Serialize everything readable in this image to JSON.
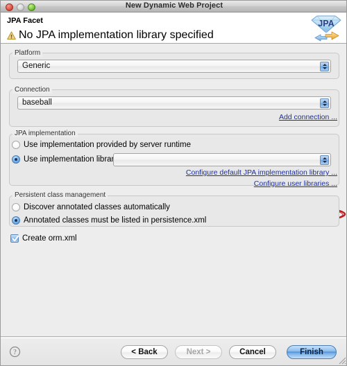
{
  "window": {
    "title": "New Dynamic Web Project",
    "controls": {
      "close": "close-button",
      "minimize": "minimize-button",
      "maximize": "maximize-button"
    }
  },
  "header": {
    "title": "JPA Facet",
    "message": "No JPA implementation library specified",
    "message_icon": "warning-icon",
    "logo_text": "JPA",
    "logo_name": "jpa-logo"
  },
  "platform_group": {
    "label": "Platform",
    "combo_value": "Generic"
  },
  "connection_group": {
    "label": "Connection",
    "combo_value": "baseball",
    "add_connection_link": "Add connection ..."
  },
  "jpa_implementation_group": {
    "label": "JPA implementation",
    "radio_server_runtime": {
      "label": "Use implementation provided by server runtime",
      "selected": false
    },
    "radio_implementation_library": {
      "label": "Use implementation library:",
      "selected": true
    },
    "library_combo_value": "",
    "configure_default_link": "Configure default JPA implementation library ...",
    "configure_user_libraries_link": "Configure user libraries ..."
  },
  "persistent_class_group": {
    "label": "Persistent class management",
    "radio_discover": {
      "label": "Discover annotated classes automatically",
      "selected": false
    },
    "radio_listed": {
      "label": "Annotated classes must be listed in persistence.xml",
      "selected": true
    }
  },
  "create_orm": {
    "label": "Create orm.xml",
    "checked": true
  },
  "annotation": {
    "name": "red-ellipse-highlight",
    "color": "#c0171c",
    "targets": "Configure default JPA implementation library ..."
  },
  "buttons": {
    "back": "< Back",
    "next": "Next >",
    "cancel": "Cancel",
    "finish": "Finish",
    "help": "?"
  },
  "colors": {
    "link": "#1b2fa0",
    "annotation_red": "#c0171c",
    "default_button_blue": "#4b8fd8",
    "window_bg": "#ededed"
  }
}
